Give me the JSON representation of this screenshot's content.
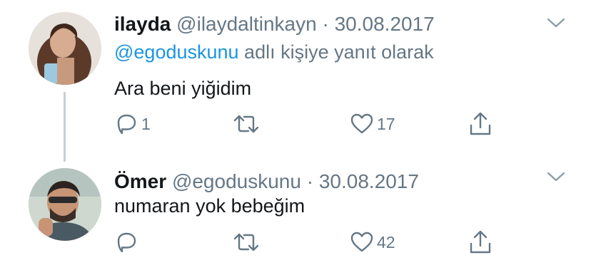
{
  "tweets": [
    {
      "name": "ilayda",
      "handle": "@ilaydaltinkayn",
      "separator": "·",
      "date": "30.08.2017",
      "reply_prefix": "@egoduskunu",
      "reply_suffix": " adlı kişiye yanıt olarak",
      "text": "Ara beni yiğidim",
      "replies": "1",
      "retweets": "",
      "likes": "17"
    },
    {
      "name": "Ömer",
      "handle": "@egoduskunu",
      "separator": "·",
      "date": "30.08.2017",
      "text": "numaran yok bebeğim",
      "replies": "",
      "retweets": "",
      "likes": "42"
    }
  ],
  "colors": {
    "name": "#14171a",
    "secondary": "#657786",
    "link": "#1b95e0",
    "thread_line": "#c6ced5"
  },
  "icons": {
    "reply": "speech-bubble-icon",
    "retweet": "retweet-arrows-icon",
    "like": "heart-icon",
    "share": "share-upload-icon",
    "menu": "chevron-down-icon"
  }
}
